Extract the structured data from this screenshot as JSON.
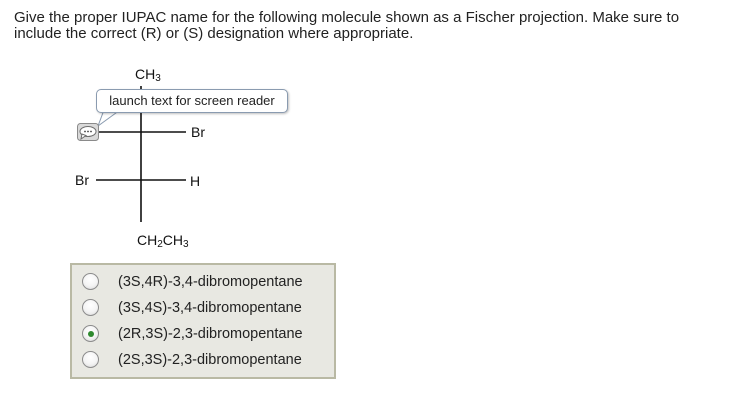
{
  "question": {
    "line1": "Give the proper IUPAC name for the following molecule shown as a Fischer projection. Make sure to",
    "line2": "include the correct (R) or (S) designation where appropriate."
  },
  "fischer": {
    "top_group": {
      "base": "CH",
      "sub": "3"
    },
    "bottom_group": {
      "base1": "CH",
      "sub1": "2",
      "base2": "CH",
      "sub2": "3"
    },
    "row1_right": "Br",
    "row2_left": "Br",
    "row2_right": "H"
  },
  "tooltip": {
    "text": "launch text for screen reader"
  },
  "screen_reader_icon": {
    "icon": "speech-bubble-icon"
  },
  "options": [
    {
      "label": "(3S,4R)-3,4-dibromopentane",
      "selected": false
    },
    {
      "label": "(3S,4S)-3,4-dibromopentane",
      "selected": false
    },
    {
      "label": "(2R,3S)-2,3-dibromopentane",
      "selected": true
    },
    {
      "label": "(2S,3S)-2,3-dibromopentane",
      "selected": false
    }
  ],
  "colors": {
    "options_bg": "#e8e8e2",
    "options_border": "#b9b9a4",
    "selected_dot": "#2f8a2f",
    "tooltip_border": "#8a9bb0"
  }
}
